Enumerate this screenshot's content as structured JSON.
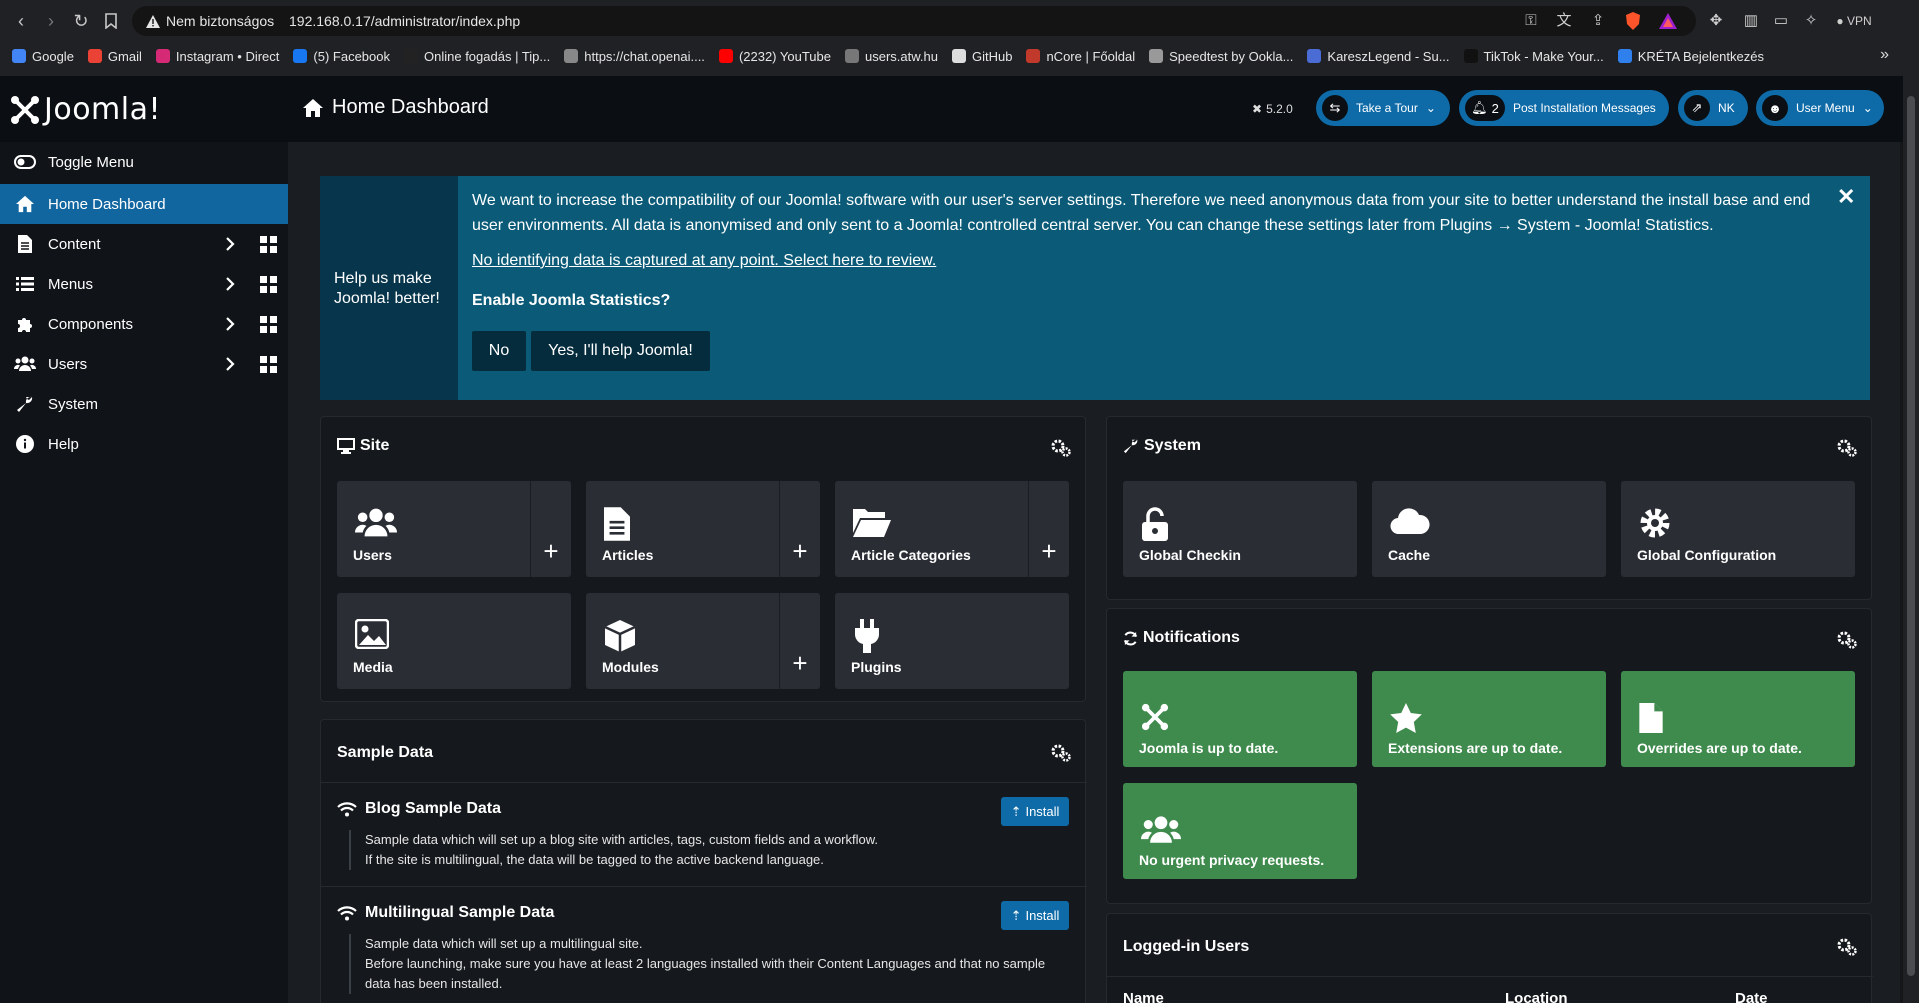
{
  "browser": {
    "insecure_label": "Nem biztonságos",
    "url": "192.168.0.17/administrator/index.php",
    "vpn_label": "VPN",
    "bookmarks": [
      {
        "label": "Google",
        "color": "#4285f4"
      },
      {
        "label": "Gmail",
        "color": "#ea4335"
      },
      {
        "label": "Instagram • Direct",
        "color": "#d62976"
      },
      {
        "label": "(5) Facebook",
        "color": "#1877f2"
      },
      {
        "label": "Online fogadás | Tip...",
        "color": "#222222"
      },
      {
        "label": "https://chat.openai....",
        "color": "#888888"
      },
      {
        "label": "(2232) YouTube",
        "color": "#ff0000"
      },
      {
        "label": "users.atw.hu",
        "color": "#777777"
      },
      {
        "label": "GitHub",
        "color": "#dddddd"
      },
      {
        "label": "nCore | Főoldal",
        "color": "#c0392b"
      },
      {
        "label": "Speedtest by Ookla...",
        "color": "#999999"
      },
      {
        "label": "KareszLegend - Su...",
        "color": "#4a6cd4"
      },
      {
        "label": "TikTok - Make Your...",
        "color": "#111111"
      },
      {
        "label": "KRÉTA Bejelentkezés",
        "color": "#2f80ed"
      }
    ]
  },
  "header": {
    "logo_text": "Joomla!",
    "title": "Home Dashboard",
    "version": "5.2.0",
    "tour_label": "Take a Tour",
    "post_install_count": "2",
    "post_install_label": "Post Installation Messages",
    "nk_label": "NK",
    "user_menu_label": "User Menu"
  },
  "sidebar": {
    "items": [
      {
        "label": "Toggle Menu"
      },
      {
        "label": "Home Dashboard"
      },
      {
        "label": "Content"
      },
      {
        "label": "Menus"
      },
      {
        "label": "Components"
      },
      {
        "label": "Users"
      },
      {
        "label": "System"
      },
      {
        "label": "Help"
      }
    ]
  },
  "stats": {
    "side_text": "Help us make Joomla! better!",
    "message": "We want to increase the compatibility of our Joomla! software with our user's server settings. Therefore we need anonymous data from your site to better understand the install base and end user environments. All data is anonymised and only sent to a Joomla! controlled central server. You can change these settings later from Plugins → System - Joomla! Statistics.",
    "link": "No identifying data is captured at any point. Select here to review.",
    "question": "Enable Joomla Statistics?",
    "no_label": "No",
    "yes_label": "Yes, I'll help Joomla!",
    "close": "✕"
  },
  "site": {
    "title": "Site",
    "tiles": [
      {
        "label": "Users"
      },
      {
        "label": "Articles"
      },
      {
        "label": "Article Categories"
      },
      {
        "label": "Media"
      },
      {
        "label": "Modules"
      },
      {
        "label": "Plugins"
      }
    ],
    "plus": "+"
  },
  "system": {
    "title": "System",
    "tiles": [
      {
        "label": "Global Checkin"
      },
      {
        "label": "Cache"
      },
      {
        "label": "Global Configuration"
      }
    ]
  },
  "notifications": {
    "title": "Notifications",
    "tiles": [
      {
        "label": "Joomla is up to date."
      },
      {
        "label": "Extensions are up to date."
      },
      {
        "label": "Overrides are up to date."
      },
      {
        "label": "No urgent privacy requests."
      }
    ]
  },
  "sample_data": {
    "title": "Sample Data",
    "install_label": "Install",
    "items": [
      {
        "title": "Blog Sample Data",
        "desc1": "Sample data which will set up a blog site with articles, tags, custom fields and a workflow.",
        "desc2": "If the site is multilingual, the data will be tagged to the active backend language."
      },
      {
        "title": "Multilingual Sample Data",
        "desc1": "Sample data which will set up a multilingual site.",
        "desc2": "Before launching, make sure you have at least 2 languages installed with their Content Languages and that no sample data has been installed."
      }
    ]
  },
  "logged_in": {
    "title": "Logged-in Users",
    "columns": [
      "Name",
      "Location",
      "Date"
    ]
  },
  "colors": {
    "accent": "#0e6ba8",
    "stats_bg": "#0b5b78",
    "notification_green": "#3f8a4d"
  }
}
